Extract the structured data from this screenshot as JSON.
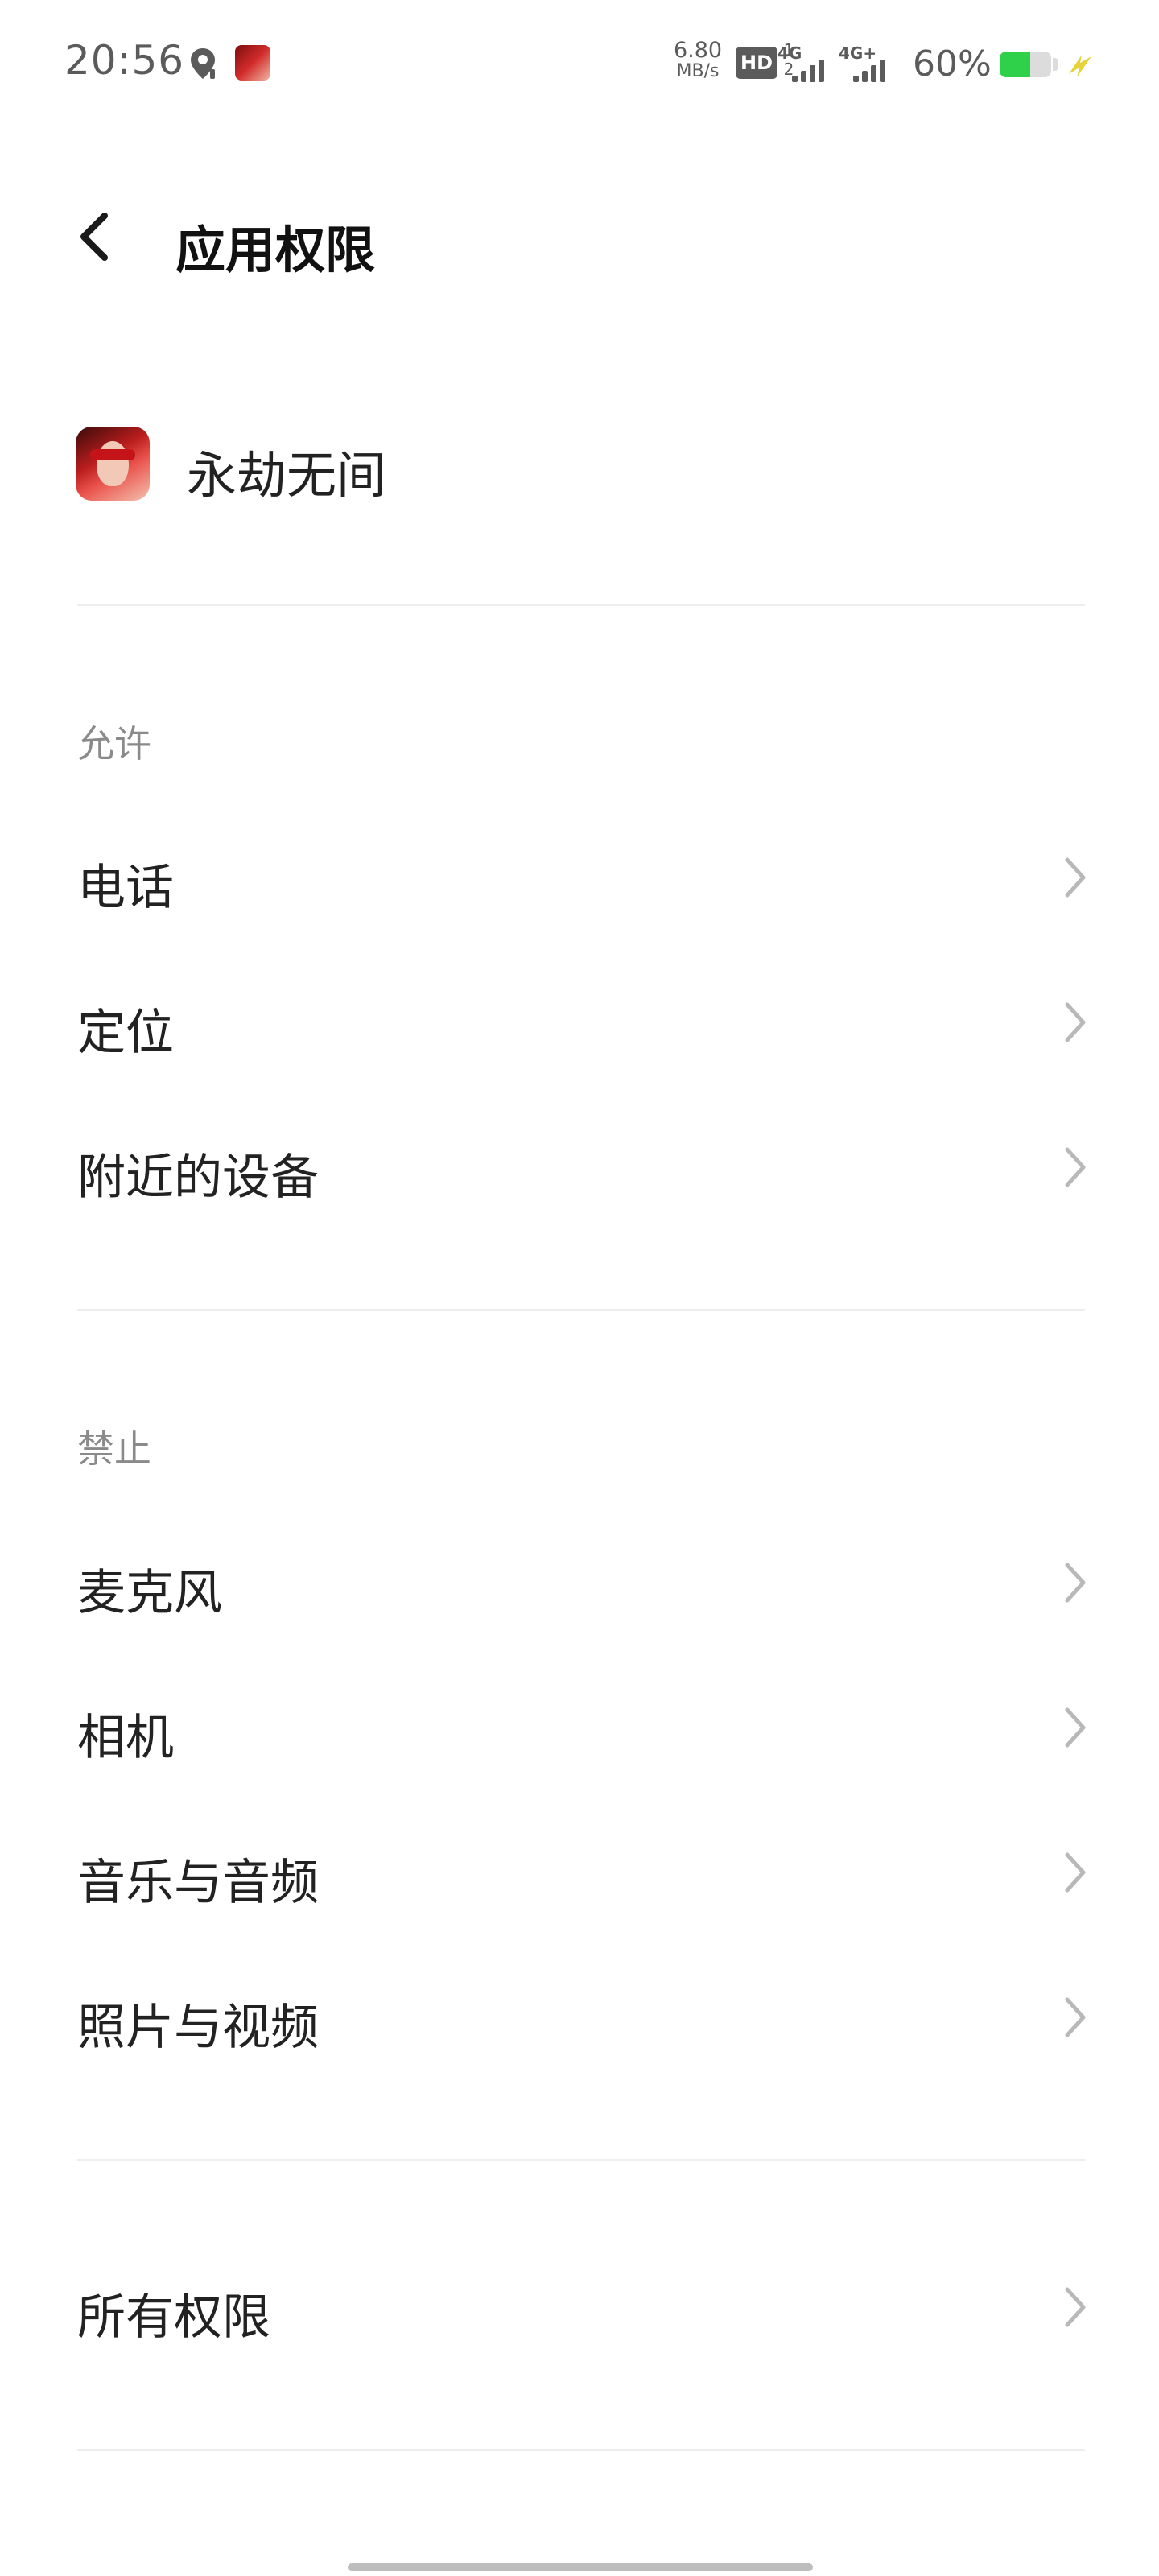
{
  "status_bar": {
    "time": "20:56",
    "net_speed_value": "6.80",
    "net_speed_unit": "MB/s",
    "hd_label": "HD",
    "hd_sub": "1 2",
    "signal1_type": "4G",
    "signal2_type": "4G+",
    "battery_percent_text": "60%",
    "battery_level": 0.6,
    "battery_color": "#2fd04a",
    "charging_bolt_color": "#e6d33a"
  },
  "header": {
    "title": "应用权限",
    "back_icon": "chevron-left-icon"
  },
  "app": {
    "name": "永劫无间",
    "icon": "app-icon"
  },
  "sections": {
    "allowed": {
      "label": "允许",
      "items": [
        "电话",
        "定位",
        "附近的设备"
      ]
    },
    "denied": {
      "label": "禁止",
      "items": [
        "麦克风",
        "相机",
        "音乐与音频",
        "照片与视频"
      ]
    },
    "all": {
      "items": [
        "所有权限"
      ]
    }
  },
  "colors": {
    "text_primary": "#222222",
    "text_secondary": "#8a8a8a",
    "chevron": "#b8b8b8",
    "divider": "#eeeeee"
  }
}
